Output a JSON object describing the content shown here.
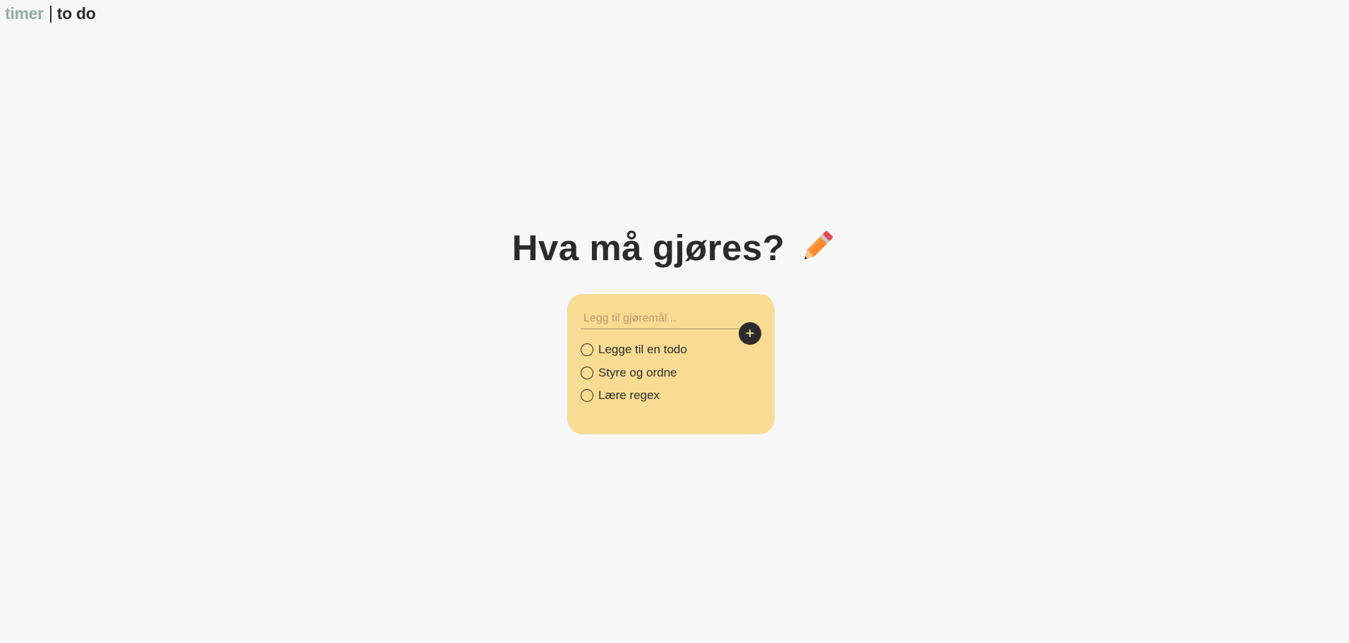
{
  "nav": {
    "timer_label": "timer",
    "todo_label": "to do"
  },
  "heading": {
    "title": "Hva må gjøres?",
    "emoji_icon": "pencil-icon"
  },
  "todo_card": {
    "input_placeholder": "Legg til gjøremål...",
    "input_value": "",
    "add_button_label": "+",
    "items": [
      {
        "label": "Legge til en todo",
        "done": false
      },
      {
        "label": "Styre og ordne",
        "done": false
      },
      {
        "label": "Lære regex",
        "done": false
      }
    ]
  },
  "colors": {
    "background": "#f7f7f7",
    "card": "#f9dc93",
    "text": "#2b2b2b",
    "inactive_nav": "#9aa7a4",
    "pencil_body": "#ff8a2a",
    "pencil_eraser": "#e8495a"
  }
}
